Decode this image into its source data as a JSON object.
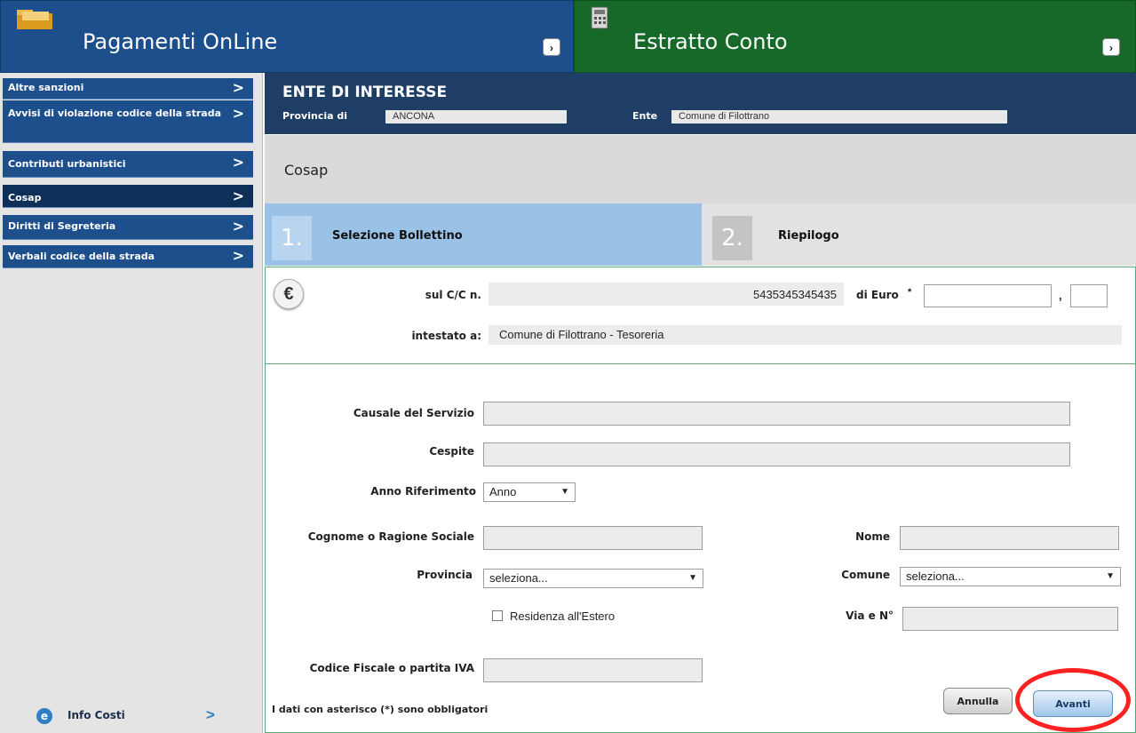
{
  "header": {
    "left_title": "Pagamenti OnLine",
    "right_title": "Estratto Conto",
    "arrow_glyph": "›",
    "colors": {
      "left_bg": "#1c4f8c",
      "right_bg": "#17692a"
    }
  },
  "sidebar": {
    "items": [
      {
        "label": "Altre sanzioni"
      },
      {
        "label": "Avvisi di violazione codice della strada"
      },
      {
        "label": "Contributi urbanistici"
      },
      {
        "label": "Cosap"
      },
      {
        "label": "Diritti di Segreteria"
      },
      {
        "label": "Verbali codice della strada"
      }
    ],
    "chevron": ">",
    "active_item": "Cosap",
    "info_costi": "Info Costi",
    "info_chevron": ">"
  },
  "ente": {
    "title": "ENTE DI INTERESSE",
    "provincia_label": "Provincia di",
    "provincia_value": "ANCONA",
    "ente_label": "Ente",
    "ente_value": "Comune di Filottrano"
  },
  "section_title": "Cosap",
  "steps": [
    {
      "number": "1.",
      "label": "Selezione Bollettino"
    },
    {
      "number": "2.",
      "label": "Riepilogo"
    }
  ],
  "bollettino": {
    "euro_symbol": "€",
    "cc_label": "sul C/C n.",
    "cc_value": "5435345345435",
    "euro_label": "di Euro",
    "asterisk": "*",
    "decimal_sep": ",",
    "intestato_label": "intestato a:",
    "intestato_value": "Comune di Filottrano - Tesoreria"
  },
  "form": {
    "causale_label": "Causale del Servizio",
    "cespite_label": "Cespite",
    "anno_label": "Anno Riferimento",
    "anno_selected": "Anno",
    "cognome_label": "Cognome o Ragione Sociale",
    "nome_label": "Nome",
    "provincia_label": "Provincia",
    "provincia_selected": "seleziona...",
    "comune_label": "Comune",
    "comune_selected": "seleziona...",
    "residenza_label": "Residenza all'Estero",
    "via_label": "Via e N°",
    "cf_label": "Codice Fiscale o partita IVA",
    "note": "I dati con asterisco (*) sono obbligatori",
    "caret": "▼"
  },
  "buttons": {
    "annulla": "Annulla",
    "avanti": "Avanti"
  }
}
